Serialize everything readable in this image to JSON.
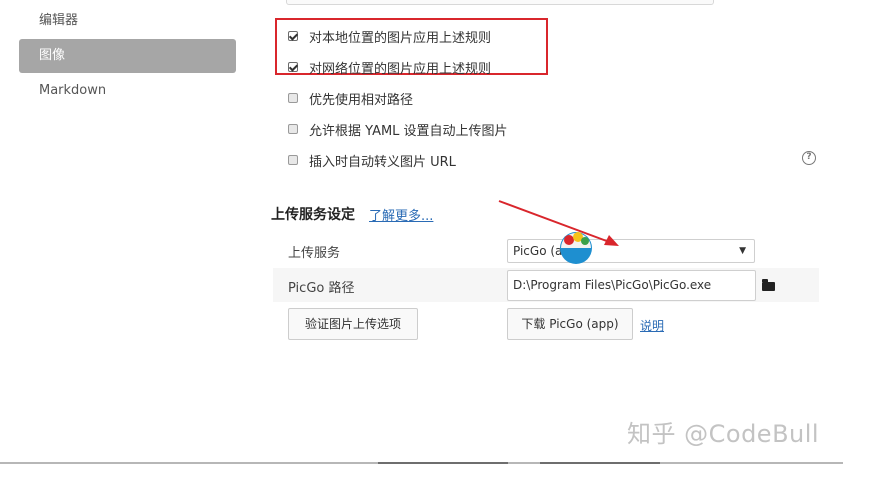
{
  "sidebar": {
    "items": [
      {
        "label": "编辑器",
        "active": false
      },
      {
        "label": "图像",
        "active": true
      },
      {
        "label": "Markdown",
        "active": false
      }
    ]
  },
  "image_rules": {
    "options": [
      {
        "label": "对本地位置的图片应用上述规则",
        "checked": true,
        "highlighted": true
      },
      {
        "label": "对网络位置的图片应用上述规则",
        "checked": true,
        "highlighted": true
      },
      {
        "label": "优先使用相对路径",
        "checked": false
      },
      {
        "label": "允许根据 YAML 设置自动上传图片",
        "checked": false
      },
      {
        "label": "插入时自动转义图片 URL",
        "checked": false
      }
    ],
    "help_icon": "question-circle-icon",
    "highlight_color": "#d9262c"
  },
  "upload": {
    "section_title": "上传服务设定",
    "learn_more": "了解更多...",
    "service_label": "上传服务",
    "service_value": "PicGo (a",
    "picgo_path_label": "PicGo 路径",
    "picgo_path_value": "D:\\Program Files\\PicGo\\PicGo.exe",
    "folder_icon": "folder-icon",
    "verify_button": "验证图片上传选项",
    "download_button": "下载 PicGo (app)",
    "explain_link": "说明"
  },
  "annotation": {
    "arrow_color": "#d9262c"
  },
  "watermark": "知乎 @CodeBull"
}
